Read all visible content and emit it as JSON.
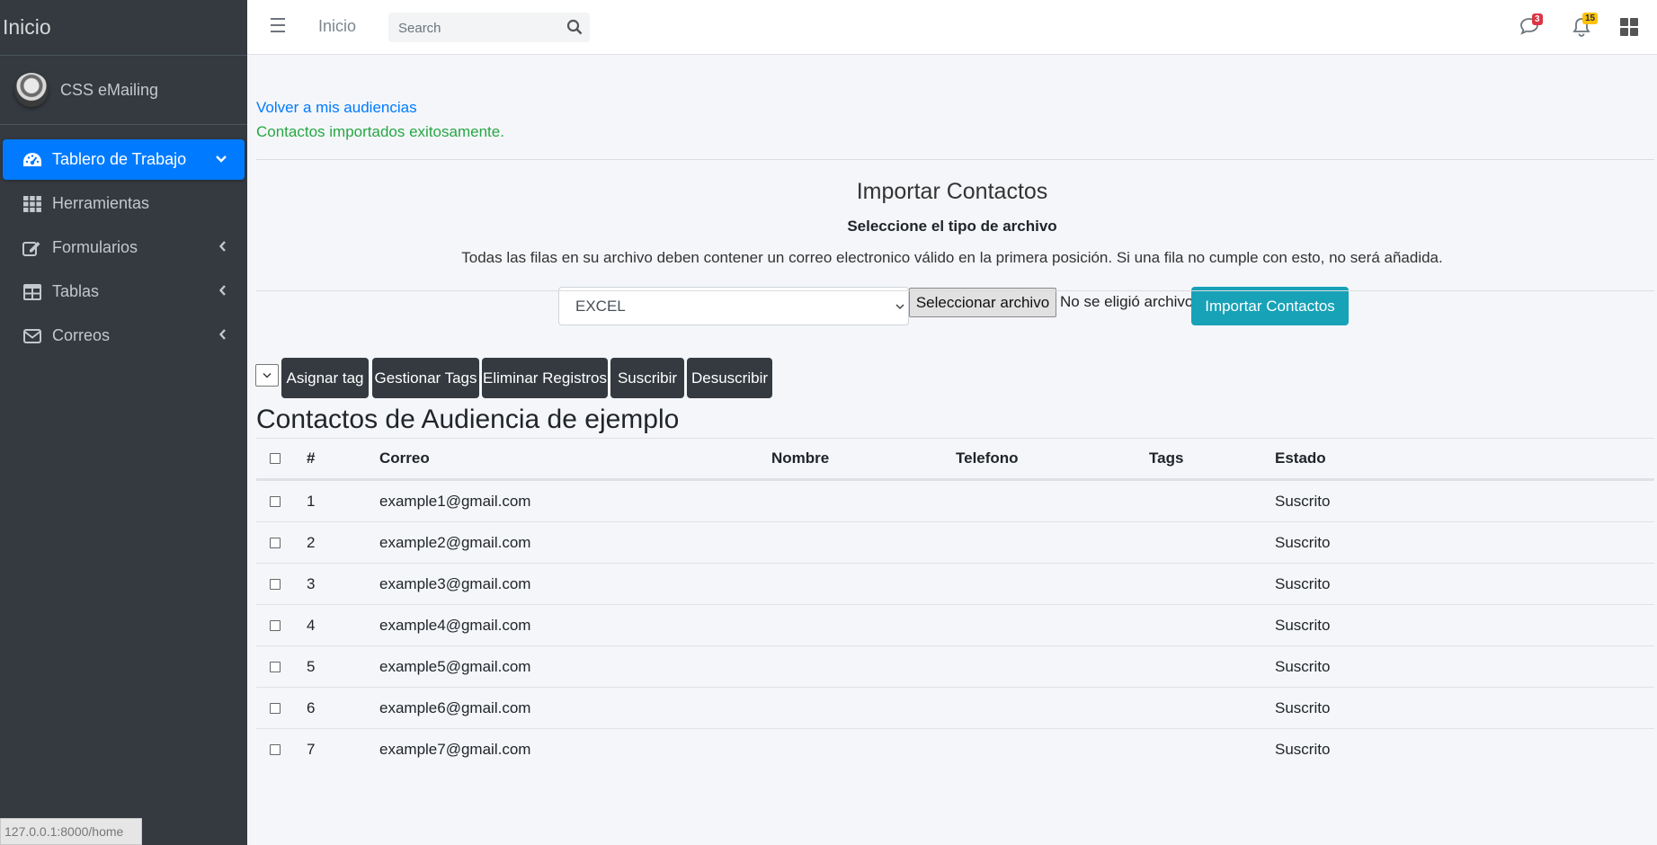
{
  "sidebar": {
    "brand": "Inicio",
    "user": "CSS eMailing",
    "items": [
      {
        "label": "Tablero de Trabajo",
        "active": true,
        "arrow": "chevron-down"
      },
      {
        "label": "Herramientas"
      },
      {
        "label": "Formularios",
        "arrow": "chevron-left"
      },
      {
        "label": "Tablas",
        "arrow": "chevron-left"
      },
      {
        "label": "Correos",
        "arrow": "chevron-left"
      }
    ]
  },
  "status_bar": {
    "url": "127.0.0.1:8000/home"
  },
  "topbar": {
    "home": "Inicio",
    "search_placeholder": "Search",
    "messages_count": "3",
    "notifications_count": "15"
  },
  "content": {
    "back_link": "Volver a mis audiencias",
    "success_message": "Contactos importados exitosamente.",
    "import": {
      "title": "Importar Contactos",
      "subtitle": "Seleccione el tipo de archivo",
      "note": "Todas las filas en su archivo deben contener un correo electronico válido en la primera posición. Si una fila no cumple con esto, no será añadida.",
      "file_type": "EXCEL",
      "choose_file": "Seleccionar archivo",
      "no_file": "No se eligió archivo",
      "import_button": "Importar Contactos"
    },
    "actions": [
      "Asignar tag",
      "Gestionar Tags",
      "Eliminar Registros",
      "Suscribir",
      "Desuscribir"
    ],
    "audience_title": "Contactos de Audiencia de ejemplo",
    "table": {
      "headers": {
        "num": "#",
        "mail": "Correo",
        "name": "Nombre",
        "phone": "Telefono",
        "tags": "Tags",
        "state": "Estado"
      },
      "rows": [
        {
          "num": "1",
          "mail": "example1@gmail.com",
          "name": "",
          "phone": "",
          "tags": "",
          "state": "Suscrito"
        },
        {
          "num": "2",
          "mail": "example2@gmail.com",
          "name": "",
          "phone": "",
          "tags": "",
          "state": "Suscrito"
        },
        {
          "num": "3",
          "mail": "example3@gmail.com",
          "name": "",
          "phone": "",
          "tags": "",
          "state": "Suscrito"
        },
        {
          "num": "4",
          "mail": "example4@gmail.com",
          "name": "",
          "phone": "",
          "tags": "",
          "state": "Suscrito"
        },
        {
          "num": "5",
          "mail": "example5@gmail.com",
          "name": "",
          "phone": "",
          "tags": "",
          "state": "Suscrito"
        },
        {
          "num": "6",
          "mail": "example6@gmail.com",
          "name": "",
          "phone": "",
          "tags": "",
          "state": "Suscrito"
        },
        {
          "num": "7",
          "mail": "example7@gmail.com",
          "name": "",
          "phone": "",
          "tags": "",
          "state": "Suscrito"
        }
      ]
    }
  }
}
